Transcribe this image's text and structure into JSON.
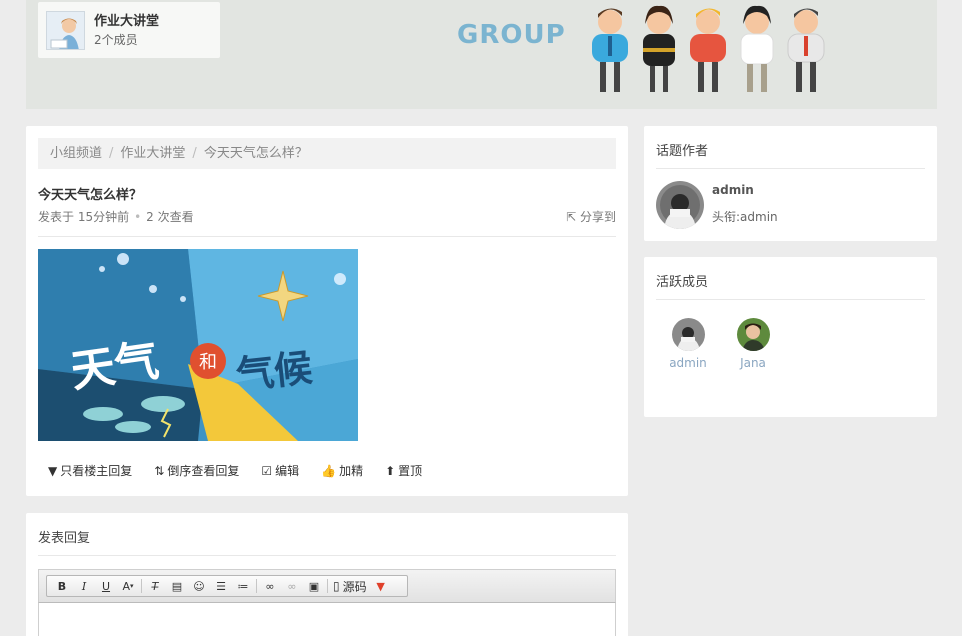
{
  "group": {
    "name": "作业大讲堂",
    "members": "2个成员",
    "banner_word": "GROUP"
  },
  "breadcrumb": {
    "item1": "小组频道",
    "item2": "作业大讲堂",
    "item3": "今天天气怎么样？",
    "separator": "/"
  },
  "post": {
    "title": "今天天气怎么样？",
    "posted": "发表于 15分钟前",
    "views": "2 次查看",
    "dot": "•",
    "share": "分享到",
    "image": {
      "word_left": "天气",
      "word_mid": "和",
      "word_right": "气候"
    }
  },
  "actions": [
    {
      "label": "只看楼主回复",
      "icon": "filter-icon"
    },
    {
      "label": "倒序查看回复",
      "icon": "sort-icon"
    },
    {
      "label": "编辑",
      "icon": "edit-icon"
    },
    {
      "label": "加精",
      "icon": "thumbs-up-icon"
    },
    {
      "label": "置顶",
      "icon": "arrow-up-circle-icon"
    }
  ],
  "author": {
    "heading": "话题作者",
    "name": "admin",
    "title": "头衔:admin"
  },
  "active_members": {
    "heading": "活跃成员",
    "members": [
      {
        "name": "admin"
      },
      {
        "name": "Jana"
      }
    ]
  },
  "reply": {
    "heading": "发表回复",
    "toolbar": {
      "bold": "B",
      "italic": "I",
      "underline": "U",
      "font_color": "A",
      "source": "源码"
    }
  },
  "colors": {
    "banner_bg": "#e2e5e1",
    "link_blue": "#8aa6c1",
    "banner_word": "#7bb4d0"
  }
}
